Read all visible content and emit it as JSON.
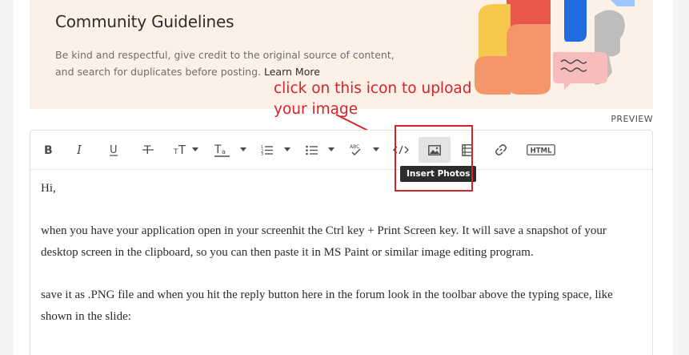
{
  "guidelines": {
    "title": "Community Guidelines",
    "body": "Be kind and respectful, give credit to the original source of content, and search for duplicates before posting.",
    "learn_more": "Learn More"
  },
  "annotation": {
    "line1": "click on this icon to upload",
    "line2": "your image"
  },
  "preview_label": "PREVIEW",
  "toolbar": {
    "tooltip": "Insert Photos",
    "html_label": "HTML",
    "spellcheck_label": "ABC"
  },
  "content": {
    "greeting": "Hi,",
    "paragraph1": "when you have your application open in your screenhit the Ctrl key + Print Screen key. It will save a snapshot of your desktop screen in the clipboard, so you can then paste it in MS Paint or similar image editing program.",
    "paragraph2": "save it as .PNG file and when you hit the reply button here in the forum look in the toolbar above the typing space, like shown in the slide:"
  },
  "colors": {
    "annotation_red": "#d3232b",
    "banner_bg": "#fdf0e6",
    "tooltip_bg": "#2d2d2d"
  }
}
